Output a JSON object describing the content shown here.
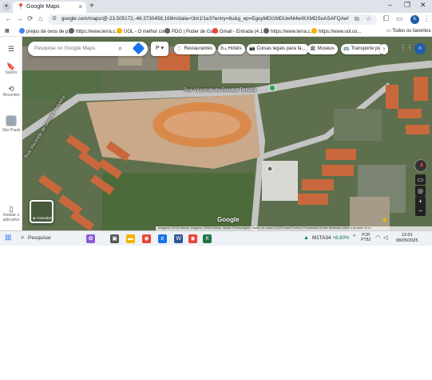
{
  "browser": {
    "tab_title": "Google Maps",
    "url": "google.com/maps/@-23.505172,-46.3730458,169m/data=!3m1!1e3?entry=ttu&g_ep=EgoyMDI1MDUwNi4wIKXMDSoASAFQAw%3D%3D",
    "bookmarks": [
      {
        "label": "prejos de ovos de p...",
        "icon_color": "#4285f4"
      },
      {
        "label": "https://www.terra.c...",
        "icon_color": "#5f6368"
      },
      {
        "label": "UOL - O melhor con...",
        "icon_color": "#f4b400"
      },
      {
        "label": "PDG | Poder de Gar...",
        "icon_color": "#5f6368"
      },
      {
        "label": "Gmail - Entrada (4.1...",
        "icon_color": "#ea4335"
      },
      {
        "label": "https://www.terra.c...",
        "icon_color": "#5f6368"
      },
      {
        "label": "https://www.uol.co...",
        "icon_color": "#f4b400"
      }
    ],
    "all_bookmarks": "Todos os favoritos",
    "profile_initial": "k"
  },
  "maps": {
    "search_placeholder": "Pesquise no Google Maps",
    "layer_value": "P",
    "chips": [
      {
        "label": "Restaurantes",
        "icon": "fork-knife-icon",
        "glyph": "🍴"
      },
      {
        "label": "Hotéis",
        "icon": "bed-icon",
        "glyph": "🛏"
      },
      {
        "label": "Coisas legais para fa...",
        "icon": "camera-icon",
        "glyph": "📷"
      },
      {
        "label": "Museus",
        "icon": "museum-icon",
        "glyph": "🏛"
      },
      {
        "label": "Transporte pú",
        "icon": "bus-icon",
        "glyph": "🚌"
      }
    ],
    "left_panel": {
      "saved": "Salvos",
      "recent": "Recentes",
      "place": "São Paulo",
      "install": "Instalar o aplicativo"
    },
    "street_name": "Rua Visconde de Guedes Teixeira",
    "street_name_2": "Rua Visconde de Guedes Teixeira",
    "layers_label": "Camadas",
    "logo": "Google",
    "attribution": "Imagens ©2025 Airbus, Imagens ©2025 Airbus, Maxar Technologies, Dados do mapa ©2025   Brasil   Termos   Privacidade   Enviar feedback sobre o produto   10 m",
    "account_initial": "n"
  },
  "taskbar": {
    "search_label": "Pesquisar",
    "ticker_symbol": "M1TA34",
    "ticker_change": "+8,90%",
    "lang_1": "POR",
    "lang_2": "PTB2",
    "time": "12:01",
    "date": "08/05/2025"
  },
  "colors": {
    "field": "#d98a4a",
    "dirt": "#c9a98a",
    "grass": "#4d6b3a",
    "road": "#c4c4c4",
    "roof": "#c9683c"
  }
}
